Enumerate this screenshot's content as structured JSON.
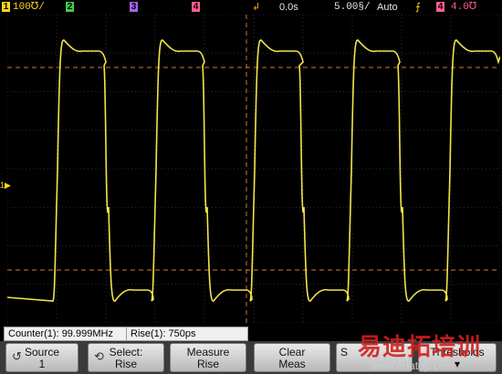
{
  "top_bar": {
    "channels": [
      {
        "number": "1",
        "scale": "100℧/",
        "color": "#ffd51e"
      },
      {
        "number": "2",
        "scale": "",
        "color": "#46c84a"
      },
      {
        "number": "3",
        "scale": "",
        "color": "#a463e6"
      },
      {
        "number": "4",
        "scale": "",
        "color": "#ff5d8f"
      }
    ],
    "trigger_marker": "↲",
    "time_delay": "0.0s",
    "time_scale": "5.00§/",
    "trigger_mode": "Auto",
    "trigger_slope_icon": "rising-edge-icon",
    "trigger_slope_glyph": "⨍",
    "trigger_source": "4",
    "trigger_level": "4.0℧"
  },
  "screen": {
    "background": "#000000",
    "grid_color": "#3a3a3a",
    "trace_color": "#f2e44a",
    "cursor_color": "#d4782a",
    "ground_marker": "1▶"
  },
  "readouts": {
    "counter": "Counter(1): 99.999MHz",
    "rise": "Rise(1): 750ps"
  },
  "softkeys": [
    {
      "line1": "Source",
      "line2": "1",
      "icon": "knob-icon"
    },
    {
      "line1": "Select:",
      "line2": "Rise",
      "icon": "rotate-icon"
    },
    {
      "line1": "Measure",
      "line2": "Rise",
      "icon": ""
    },
    {
      "line1": "Clear",
      "line2": "Meas",
      "icon": ""
    },
    {
      "line1": "S",
      "line2": "",
      "icon": ""
    },
    {
      "line1": "Thresholds",
      "line2": "",
      "icon": "down-arrow-icon"
    }
  ],
  "watermark": {
    "text_cn": "易迪拓培训",
    "url": "www.edatop.com"
  }
}
